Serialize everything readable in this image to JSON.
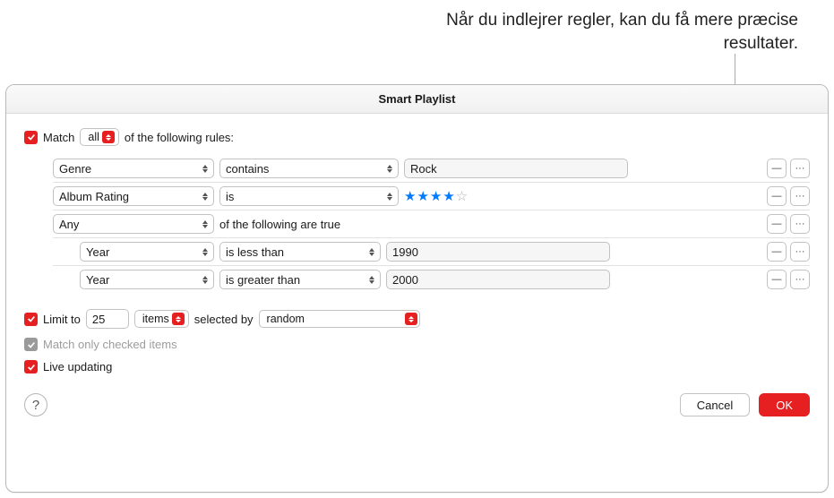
{
  "annotation": "Når du indlejrer regler, kan du få mere præcise resultater.",
  "dialog": {
    "title": "Smart Playlist"
  },
  "match": {
    "label_prefix": "Match",
    "quantifier": "all",
    "label_suffix": "of the following rules:"
  },
  "rules": [
    {
      "field": "Genre",
      "op": "contains",
      "value": "Rock",
      "kind": "text",
      "nested": false
    },
    {
      "field": "Album Rating",
      "op": "is",
      "value": 4,
      "kind": "stars",
      "nested": false
    },
    {
      "field": "Any",
      "label_after": "of the following are true",
      "kind": "group",
      "nested": false
    },
    {
      "field": "Year",
      "op": "is less than",
      "value": "1990",
      "kind": "text",
      "nested": true
    },
    {
      "field": "Year",
      "op": "is greater than",
      "value": "2000",
      "kind": "text",
      "nested": true
    }
  ],
  "limit": {
    "label": "Limit to",
    "count": "25",
    "unit": "items",
    "selected_by_label": "selected by",
    "selected_by": "random"
  },
  "match_only_checked": "Match only checked items",
  "live_updating": "Live updating",
  "buttons": {
    "help": "?",
    "cancel": "Cancel",
    "ok": "OK",
    "minus": "—",
    "more": "···"
  }
}
